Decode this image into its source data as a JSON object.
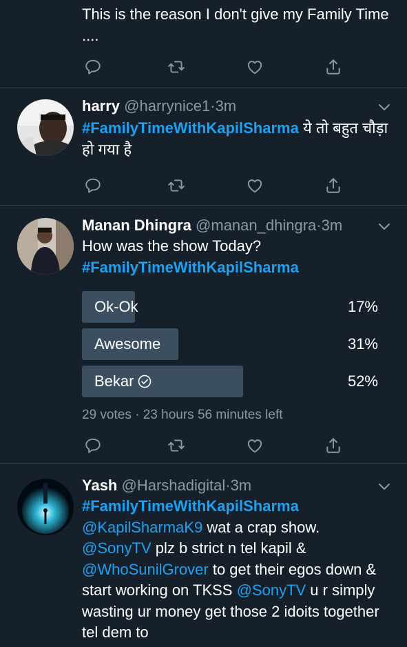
{
  "colors": {
    "background": "#15202b",
    "divider": "#38444d",
    "link": "#1da1f2",
    "muted": "#8899a6",
    "poll_bar": "#3b4f61"
  },
  "tweet0": {
    "text": "This is the reason I don't give my Family Time ...."
  },
  "tweet1": {
    "name": "harry",
    "handle": "@harrynice1",
    "time": "3m",
    "hashtag": "#FamilyTimeWithKapilSharma",
    "text": "ये तो बहुत चौड़ा हो गया है"
  },
  "tweet2": {
    "name": "Manan Dhingra",
    "handle": "@manan_dhingra",
    "time": "3m",
    "text": "How was the show Today?",
    "hashtag": "#FamilyTimeWithKapilSharma",
    "poll": {
      "options": [
        {
          "label": "Ok-Ok",
          "percent_text": "17%",
          "percent": 17,
          "selected": false
        },
        {
          "label": "Awesome",
          "percent_text": "31%",
          "percent": 31,
          "selected": false
        },
        {
          "label": "Bekar",
          "percent_text": "52%",
          "percent": 52,
          "selected": true
        }
      ],
      "votes": "29 votes",
      "time_left": "23 hours 56 minutes left"
    }
  },
  "tweet3": {
    "name": "Yash",
    "handle": "@Harshadigital",
    "time": "3m",
    "hashtag": "#FamilyTimeWithKapilSharma",
    "mention_kapil": "@KapilSharmaK9",
    "text1": " wat a crap show.",
    "mention_sony1": "@SonyTV",
    "text2": " plz b strict n tel kapil &",
    "mention_sunil": "@WhoSunilGrover",
    "text3": " to get their egos down & start working on TKSS",
    "mention_sony2": "@SonyTV",
    "text4": " u r simply wasting ur money get those 2 idoits together tel dem to"
  },
  "separator": "·",
  "icons": [
    "reply-icon",
    "retweet-icon",
    "like-icon",
    "share-icon",
    "chevron-down-icon",
    "check-circle-icon"
  ]
}
